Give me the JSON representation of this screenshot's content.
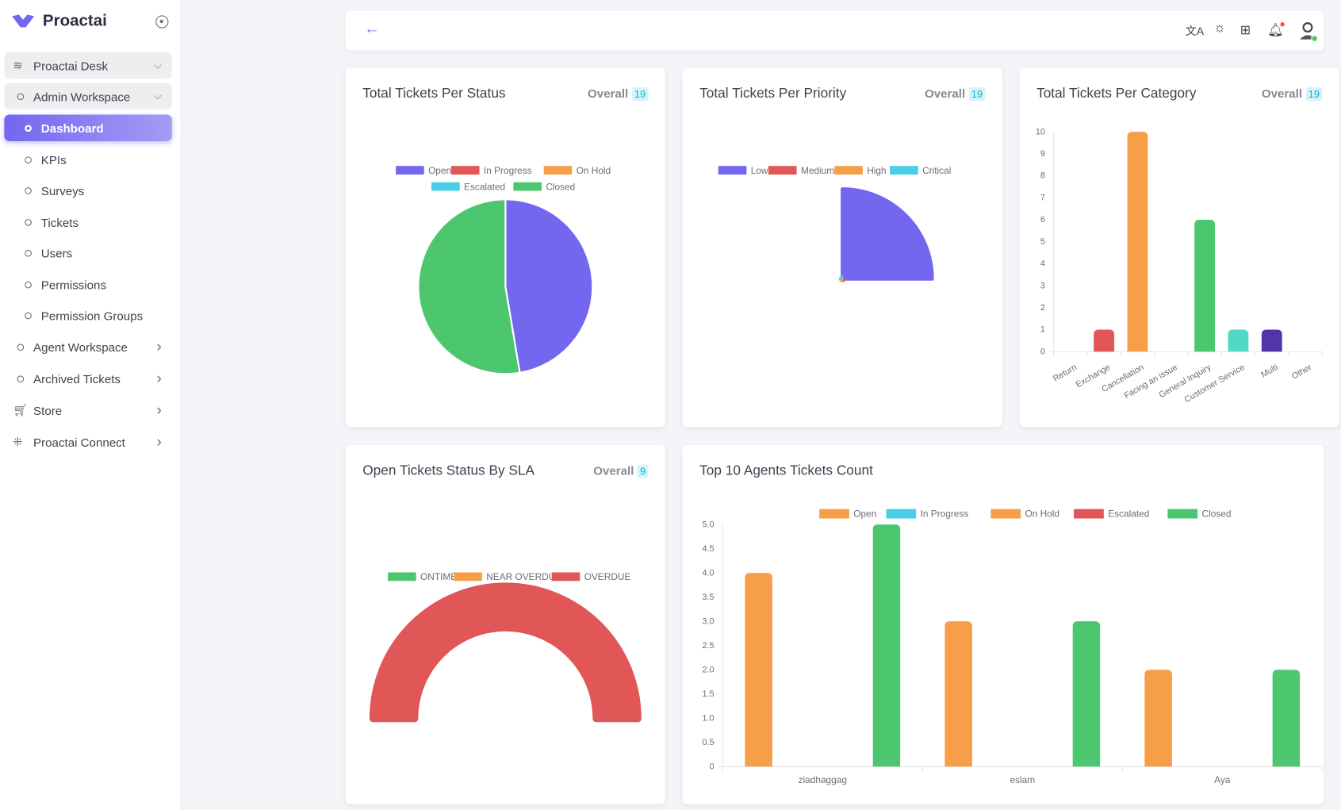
{
  "sidebar": {
    "brand": "Proactai",
    "items": [
      {
        "label": "Proactai Desk",
        "icon": "layers-icon",
        "chevron": "down"
      },
      {
        "label": "Admin Workspace",
        "icon": "circle-icon",
        "chevron": "down"
      },
      {
        "label": "Dashboard",
        "icon": "circle-icon",
        "active": true
      },
      {
        "label": "KPIs",
        "icon": "circle-icon"
      },
      {
        "label": "Surveys",
        "icon": "circle-icon"
      },
      {
        "label": "Tickets",
        "icon": "circle-icon"
      },
      {
        "label": "Users",
        "icon": "circle-icon"
      },
      {
        "label": "Permissions",
        "icon": "circle-icon"
      },
      {
        "label": "Permission Groups",
        "icon": "circle-icon"
      },
      {
        "label": "Agent Workspace",
        "icon": "circle-icon",
        "chevron": "right"
      },
      {
        "label": "Archived Tickets",
        "icon": "circle-icon",
        "chevron": "right"
      },
      {
        "label": "Store",
        "icon": "cart-icon",
        "chevron": "right"
      },
      {
        "label": "Proactai Connect",
        "icon": "network-icon",
        "chevron": "right"
      }
    ]
  },
  "topbar": {
    "icons": [
      "translate-icon",
      "sun-icon",
      "add-widget-icon",
      "bell-icon",
      "avatar-icon"
    ]
  },
  "colors": {
    "accent": "#7367f0",
    "open": "#7367f0",
    "closed": "#4cc76f",
    "red": "#e15656",
    "orange": "#f79f48",
    "cyan": "#4acde6",
    "teal": "#52d9c4",
    "indigo": "#5235a8"
  },
  "cards": {
    "overall_label": "Overall"
  },
  "chart_data": [
    {
      "id": "status",
      "type": "pie",
      "title": "Total Tickets Per Status",
      "overall": "19",
      "legend": [
        "Open",
        "In Progress",
        "On Hold",
        "Escalated",
        "Closed"
      ],
      "colors": [
        "#7367f0",
        "#e15656",
        "#f79f48",
        "#4acde6",
        "#4cc76f"
      ],
      "values": [
        9,
        0,
        0,
        0,
        10
      ]
    },
    {
      "id": "priority",
      "type": "polarArea",
      "title": "Total Tickets Per Priority",
      "overall": "19",
      "legend": [
        "Low",
        "Medium",
        "High",
        "Critical"
      ],
      "colors": [
        "#7367f0",
        "#e15656",
        "#f79f48",
        "#4acde6"
      ],
      "values": [
        19,
        0,
        0,
        0
      ]
    },
    {
      "id": "category",
      "type": "bar",
      "title": "Total Tickets Per Category",
      "overall": "19",
      "categories": [
        "Return",
        "Exchange",
        "Cancellation",
        "Facing an issue",
        "General Inquiry",
        "Customer Service",
        "Multi",
        "Other"
      ],
      "values": [
        0,
        1,
        10,
        0,
        6,
        1,
        1,
        0
      ],
      "colors": [
        "#7367f0",
        "#e15656",
        "#f79f48",
        "#4acde6",
        "#4cc76f",
        "#52d9c4",
        "#5235a8",
        "#7367f0"
      ],
      "ylim": [
        0,
        10
      ],
      "yticks": [
        "0",
        "1",
        "2",
        "3",
        "4",
        "5",
        "6",
        "7",
        "8",
        "9",
        "10"
      ]
    },
    {
      "id": "sla",
      "type": "doughnut-half",
      "title": "Open Tickets Status By SLA",
      "overall": "9",
      "legend": [
        "ONTIME",
        "NEAR OVERDUE",
        "OVERDUE"
      ],
      "colors": [
        "#4cc76f",
        "#f79f48",
        "#e15656"
      ],
      "values": [
        0,
        0,
        9
      ]
    },
    {
      "id": "agents",
      "type": "bar",
      "title": "Top 10 Agents Tickets Count",
      "categories": [
        "ziadhaggag",
        "eslam",
        "Aya"
      ],
      "series": [
        {
          "name": "Open",
          "color": "#f79f48",
          "values": [
            4,
            3,
            2
          ]
        },
        {
          "name": "In Progress",
          "color": "#4acde6",
          "values": [
            0,
            0,
            0
          ]
        },
        {
          "name": "On Hold",
          "color": "#f79f48",
          "values": [
            0,
            0,
            0
          ]
        },
        {
          "name": "Escalated",
          "color": "#e15656",
          "values": [
            0,
            0,
            0
          ]
        },
        {
          "name": "Closed",
          "color": "#4cc76f",
          "values": [
            5,
            3,
            2
          ]
        }
      ],
      "ylim": [
        0,
        5
      ],
      "yticks": [
        "0",
        "0.5",
        "1.0",
        "1.5",
        "2.0",
        "2.5",
        "3.0",
        "3.5",
        "4.0",
        "4.5",
        "5.0"
      ]
    }
  ]
}
